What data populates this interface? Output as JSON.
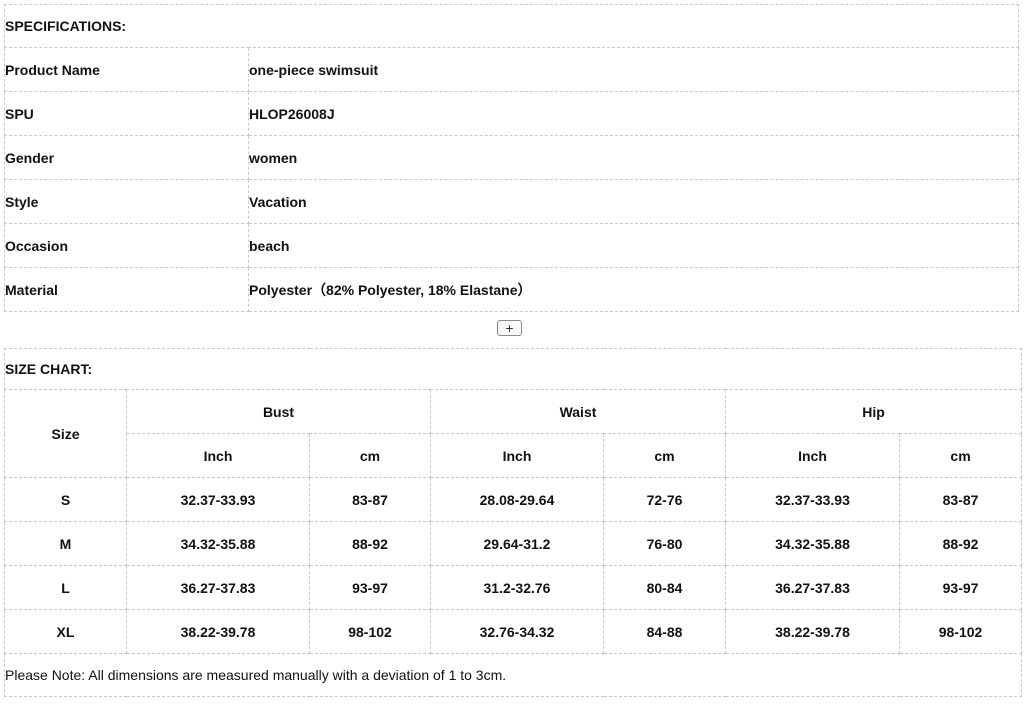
{
  "specifications": {
    "title": "SPECIFICATIONS:",
    "rows": [
      {
        "key": "Product  Name",
        "value": "one-piece swimsuit"
      },
      {
        "key": "SPU",
        "value": "HLOP26008J"
      },
      {
        "key": "Gender",
        "value": "women"
      },
      {
        "key": "Style",
        "value": "Vacation"
      },
      {
        "key": "Occasion",
        "value": "beach"
      },
      {
        "key": "Material",
        "value": "Polyester（82% Polyester, 18% Elastane）"
      }
    ]
  },
  "expand": {
    "label": "+"
  },
  "size_chart": {
    "title": "SIZE CHART:",
    "size_header": "Size",
    "groups": [
      "Bust",
      "Waist",
      "Hip"
    ],
    "units": [
      "Inch",
      "cm",
      "Inch",
      "cm",
      "Inch",
      "cm"
    ],
    "rows": [
      {
        "size": "S",
        "cells": [
          "32.37-33.93",
          "83-87",
          "28.08-29.64",
          "72-76",
          "32.37-33.93",
          "83-87"
        ]
      },
      {
        "size": "M",
        "cells": [
          "34.32-35.88",
          "88-92",
          "29.64-31.2",
          "76-80",
          "34.32-35.88",
          "88-92"
        ]
      },
      {
        "size": "L",
        "cells": [
          "36.27-37.83",
          "93-97",
          "31.2-32.76",
          "80-84",
          "36.27-37.83",
          "93-97"
        ]
      },
      {
        "size": "XL",
        "cells": [
          "38.22-39.78",
          "98-102",
          "32.76-34.32",
          "84-88",
          "38.22-39.78",
          "98-102"
        ]
      }
    ],
    "note": "Please Note:  All dimensions are measured manually with a deviation of 1 to 3cm."
  }
}
